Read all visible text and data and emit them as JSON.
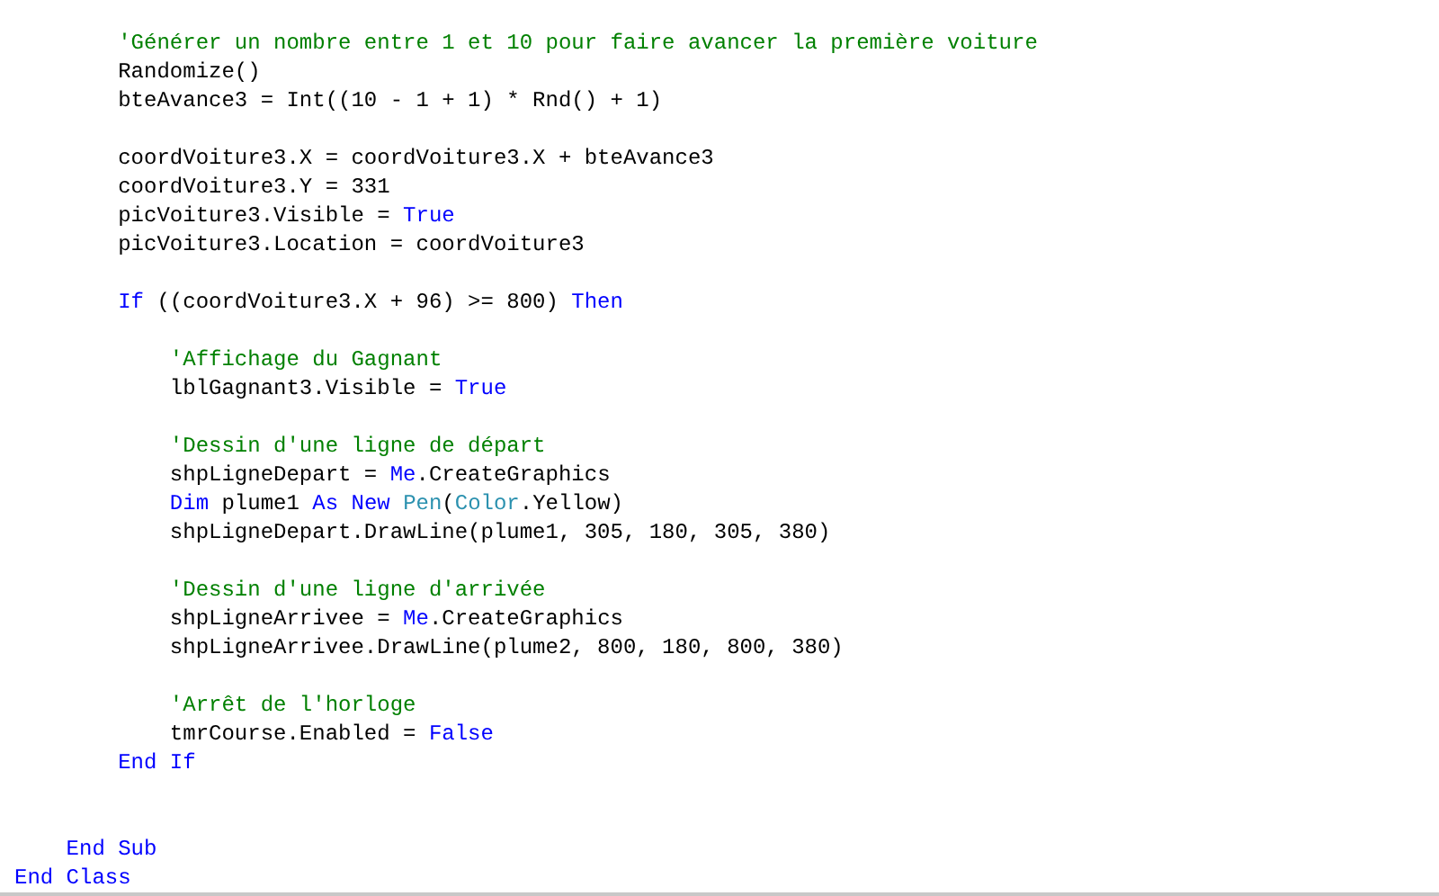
{
  "editor": {
    "lines": [
      {
        "kind": "code",
        "tokens": [
          {
            "kind": "comment",
            "text": "        'Générer un nombre entre 1 et 10 pour faire avancer la première voiture"
          }
        ]
      },
      {
        "kind": "code",
        "tokens": [
          {
            "kind": "plain",
            "text": "        Randomize()"
          }
        ]
      },
      {
        "kind": "code",
        "tokens": [
          {
            "kind": "plain",
            "text": "        bteAvance3 = Int((10 - 1 + 1) * Rnd() + 1)"
          }
        ]
      },
      {
        "kind": "blank"
      },
      {
        "kind": "code",
        "tokens": [
          {
            "kind": "plain",
            "text": "        coordVoiture3.X = coordVoiture3.X + bteAvance3"
          }
        ]
      },
      {
        "kind": "code",
        "tokens": [
          {
            "kind": "plain",
            "text": "        coordVoiture3.Y = 331"
          }
        ]
      },
      {
        "kind": "code",
        "tokens": [
          {
            "kind": "plain",
            "text": "        picVoiture3.Visible = "
          },
          {
            "kind": "keyword",
            "text": "True"
          }
        ]
      },
      {
        "kind": "code",
        "tokens": [
          {
            "kind": "plain",
            "text": "        picVoiture3.Location = coordVoiture3"
          }
        ]
      },
      {
        "kind": "blank"
      },
      {
        "kind": "code",
        "tokens": [
          {
            "kind": "keyword",
            "text": "        If"
          },
          {
            "kind": "plain",
            "text": " ((coordVoiture3.X + 96) >= 800) "
          },
          {
            "kind": "keyword",
            "text": "Then"
          }
        ]
      },
      {
        "kind": "blank"
      },
      {
        "kind": "code",
        "tokens": [
          {
            "kind": "comment",
            "text": "            'Affichage du Gagnant"
          }
        ]
      },
      {
        "kind": "code",
        "tokens": [
          {
            "kind": "plain",
            "text": "            lblGagnant3.Visible = "
          },
          {
            "kind": "keyword",
            "text": "True"
          }
        ]
      },
      {
        "kind": "blank"
      },
      {
        "kind": "code",
        "tokens": [
          {
            "kind": "comment",
            "text": "            'Dessin d'une ligne de départ"
          }
        ]
      },
      {
        "kind": "code",
        "tokens": [
          {
            "kind": "plain",
            "text": "            shpLigneDepart = "
          },
          {
            "kind": "keyword",
            "text": "Me"
          },
          {
            "kind": "plain",
            "text": ".CreateGraphics"
          }
        ]
      },
      {
        "kind": "code",
        "tokens": [
          {
            "kind": "keyword",
            "text": "            Dim"
          },
          {
            "kind": "plain",
            "text": " plume1 "
          },
          {
            "kind": "keyword",
            "text": "As New "
          },
          {
            "kind": "type",
            "text": "Pen"
          },
          {
            "kind": "plain",
            "text": "("
          },
          {
            "kind": "type",
            "text": "Color"
          },
          {
            "kind": "plain",
            "text": ".Yellow)"
          }
        ]
      },
      {
        "kind": "code",
        "tokens": [
          {
            "kind": "plain",
            "text": "            shpLigneDepart.DrawLine(plume1, 305, 180, 305, 380)"
          }
        ]
      },
      {
        "kind": "blank"
      },
      {
        "kind": "code",
        "tokens": [
          {
            "kind": "comment",
            "text": "            'Dessin d'une ligne d'arrivée"
          }
        ]
      },
      {
        "kind": "code",
        "tokens": [
          {
            "kind": "plain",
            "text": "            shpLigneArrivee = "
          },
          {
            "kind": "keyword",
            "text": "Me"
          },
          {
            "kind": "plain",
            "text": ".CreateGraphics"
          }
        ]
      },
      {
        "kind": "code",
        "tokens": [
          {
            "kind": "plain",
            "text": "            shpLigneArrivee.DrawLine(plume2, 800, 180, 800, 380)"
          }
        ]
      },
      {
        "kind": "blank"
      },
      {
        "kind": "code",
        "tokens": [
          {
            "kind": "comment",
            "text": "            'Arrêt de l'horloge"
          }
        ]
      },
      {
        "kind": "code",
        "tokens": [
          {
            "kind": "plain",
            "text": "            tmrCourse.Enabled = "
          },
          {
            "kind": "keyword",
            "text": "False"
          }
        ]
      },
      {
        "kind": "code",
        "tokens": [
          {
            "kind": "keyword",
            "text": "        End If"
          }
        ]
      },
      {
        "kind": "blank"
      },
      {
        "kind": "blank"
      },
      {
        "kind": "code",
        "tokens": [
          {
            "kind": "keyword",
            "text": "    End Sub"
          }
        ]
      },
      {
        "kind": "code",
        "tokens": [
          {
            "kind": "keyword",
            "text": "End Class"
          }
        ]
      }
    ]
  }
}
